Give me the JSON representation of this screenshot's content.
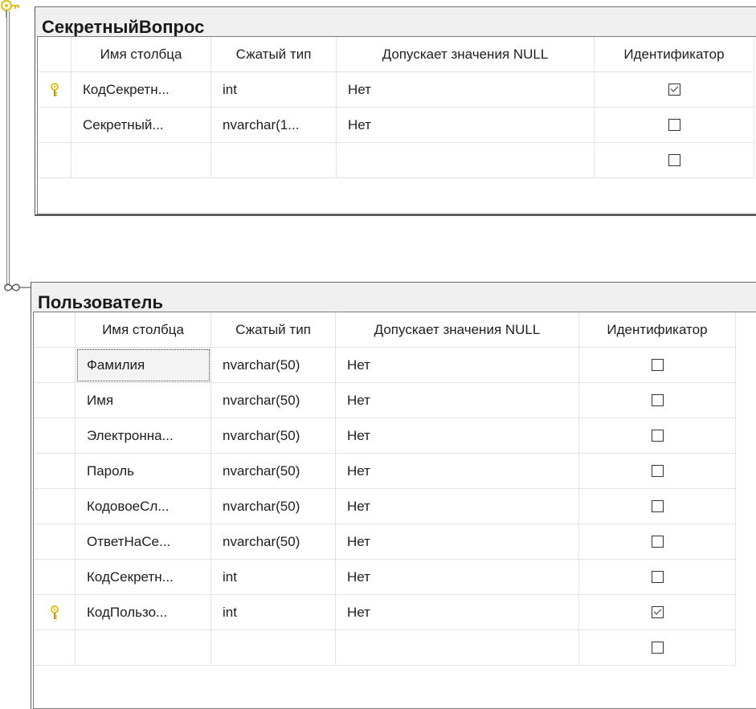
{
  "headers": {
    "select": "",
    "column_name": "Имя столбца",
    "type": "Сжатый тип",
    "nullable": "Допускает значения NULL",
    "identity": "Идентификатор"
  },
  "tables": [
    {
      "name": "СекретныйВопрос",
      "rows": [
        {
          "key": true,
          "column": "КодСекретн...",
          "type": "int",
          "nullable": "Нет",
          "identity": true
        },
        {
          "key": false,
          "column": "Секретный...",
          "type": "nvarchar(1...",
          "nullable": "Нет",
          "identity": false
        },
        {
          "key": false,
          "column": "",
          "type": "",
          "nullable": "",
          "identity": false
        }
      ]
    },
    {
      "name": "Пользователь",
      "rows": [
        {
          "key": false,
          "column": "Фамилия",
          "type": "nvarchar(50)",
          "nullable": "Нет",
          "identity": false
        },
        {
          "key": false,
          "column": "Имя",
          "type": "nvarchar(50)",
          "nullable": "Нет",
          "identity": false
        },
        {
          "key": false,
          "column": "Электронна...",
          "type": "nvarchar(50)",
          "nullable": "Нет",
          "identity": false
        },
        {
          "key": false,
          "column": "Пароль",
          "type": "nvarchar(50)",
          "nullable": "Нет",
          "identity": false
        },
        {
          "key": false,
          "column": "КодовоеСл...",
          "type": "nvarchar(50)",
          "nullable": "Нет",
          "identity": false
        },
        {
          "key": false,
          "column": "ОтветНаСе...",
          "type": "nvarchar(50)",
          "nullable": "Нет",
          "identity": false
        },
        {
          "key": false,
          "column": "КодСекретн...",
          "type": "int",
          "nullable": "Нет",
          "identity": false
        },
        {
          "key": true,
          "column": "КодПользо...",
          "type": "int",
          "nullable": "Нет",
          "identity": true
        },
        {
          "key": false,
          "column": "",
          "type": "",
          "nullable": "",
          "identity": false
        }
      ]
    }
  ],
  "colors": {
    "key_icon": "#e0c21a",
    "connector": "#8a8a8a",
    "title_bg": "#f0f0f0"
  },
  "icons": {
    "primary_key": "key-icon",
    "relationship_one": "key-end-icon",
    "relationship_many": "infinity-end-icon"
  }
}
